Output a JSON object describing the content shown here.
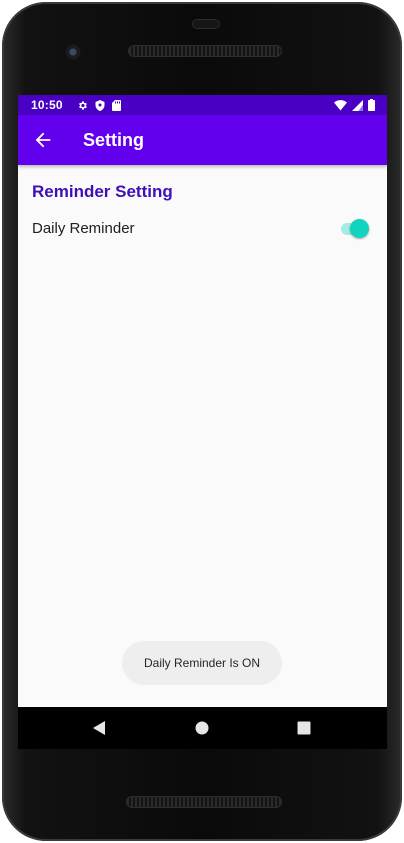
{
  "status_bar": {
    "time": "10:50",
    "icons_left": [
      "settings-icon",
      "shield-icon",
      "sd-card-icon"
    ],
    "icons_right": [
      "wifi-icon",
      "signal-icon",
      "battery-icon"
    ]
  },
  "app_bar": {
    "title": "Setting",
    "back_icon": "arrow-back-icon"
  },
  "preferences": {
    "section_title": "Reminder Setting",
    "daily_reminder_label": "Daily Reminder",
    "daily_reminder_enabled": true
  },
  "toast": {
    "message": "Daily Reminder Is ON"
  },
  "nav_bar": {
    "buttons": [
      "back-triangle-icon",
      "home-circle-icon",
      "recents-square-icon"
    ]
  },
  "colors": {
    "status_bar": "#4a00c2",
    "app_bar": "#6200ee",
    "section_title": "#3f0fb8",
    "switch_thumb": "#12d3c0",
    "switch_track": "#a4ece2",
    "screen_background": "#fafafa"
  }
}
